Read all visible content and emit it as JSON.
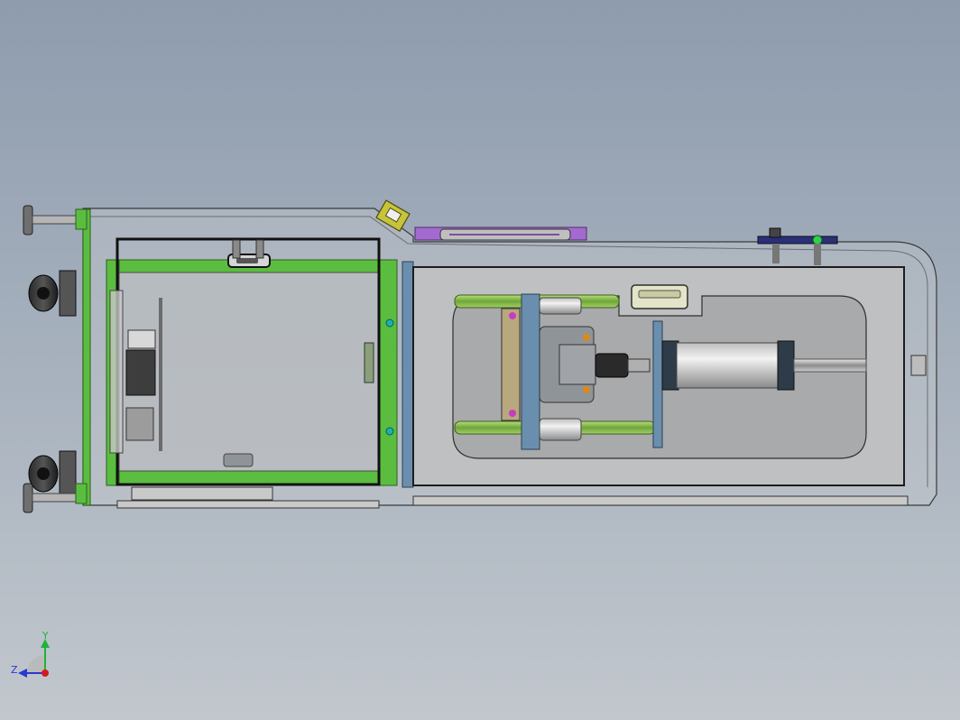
{
  "viewport": {
    "background_top": "#8e9cae",
    "background_bottom": "#c2c7cd"
  },
  "triad": {
    "y_label": "Y",
    "z_label": "Z",
    "y_color": "#1fb33a",
    "z_color": "#2c37d0",
    "x_color": "#d01c1c"
  },
  "colors": {
    "frame_green": "#5bbd3f",
    "tube_green": "#8fc850",
    "plate_blue": "#6a8fae",
    "accent_purple": "#a36bd0",
    "accent_yellow": "#c8c43a",
    "accent_teal": "#1bb1b1"
  }
}
